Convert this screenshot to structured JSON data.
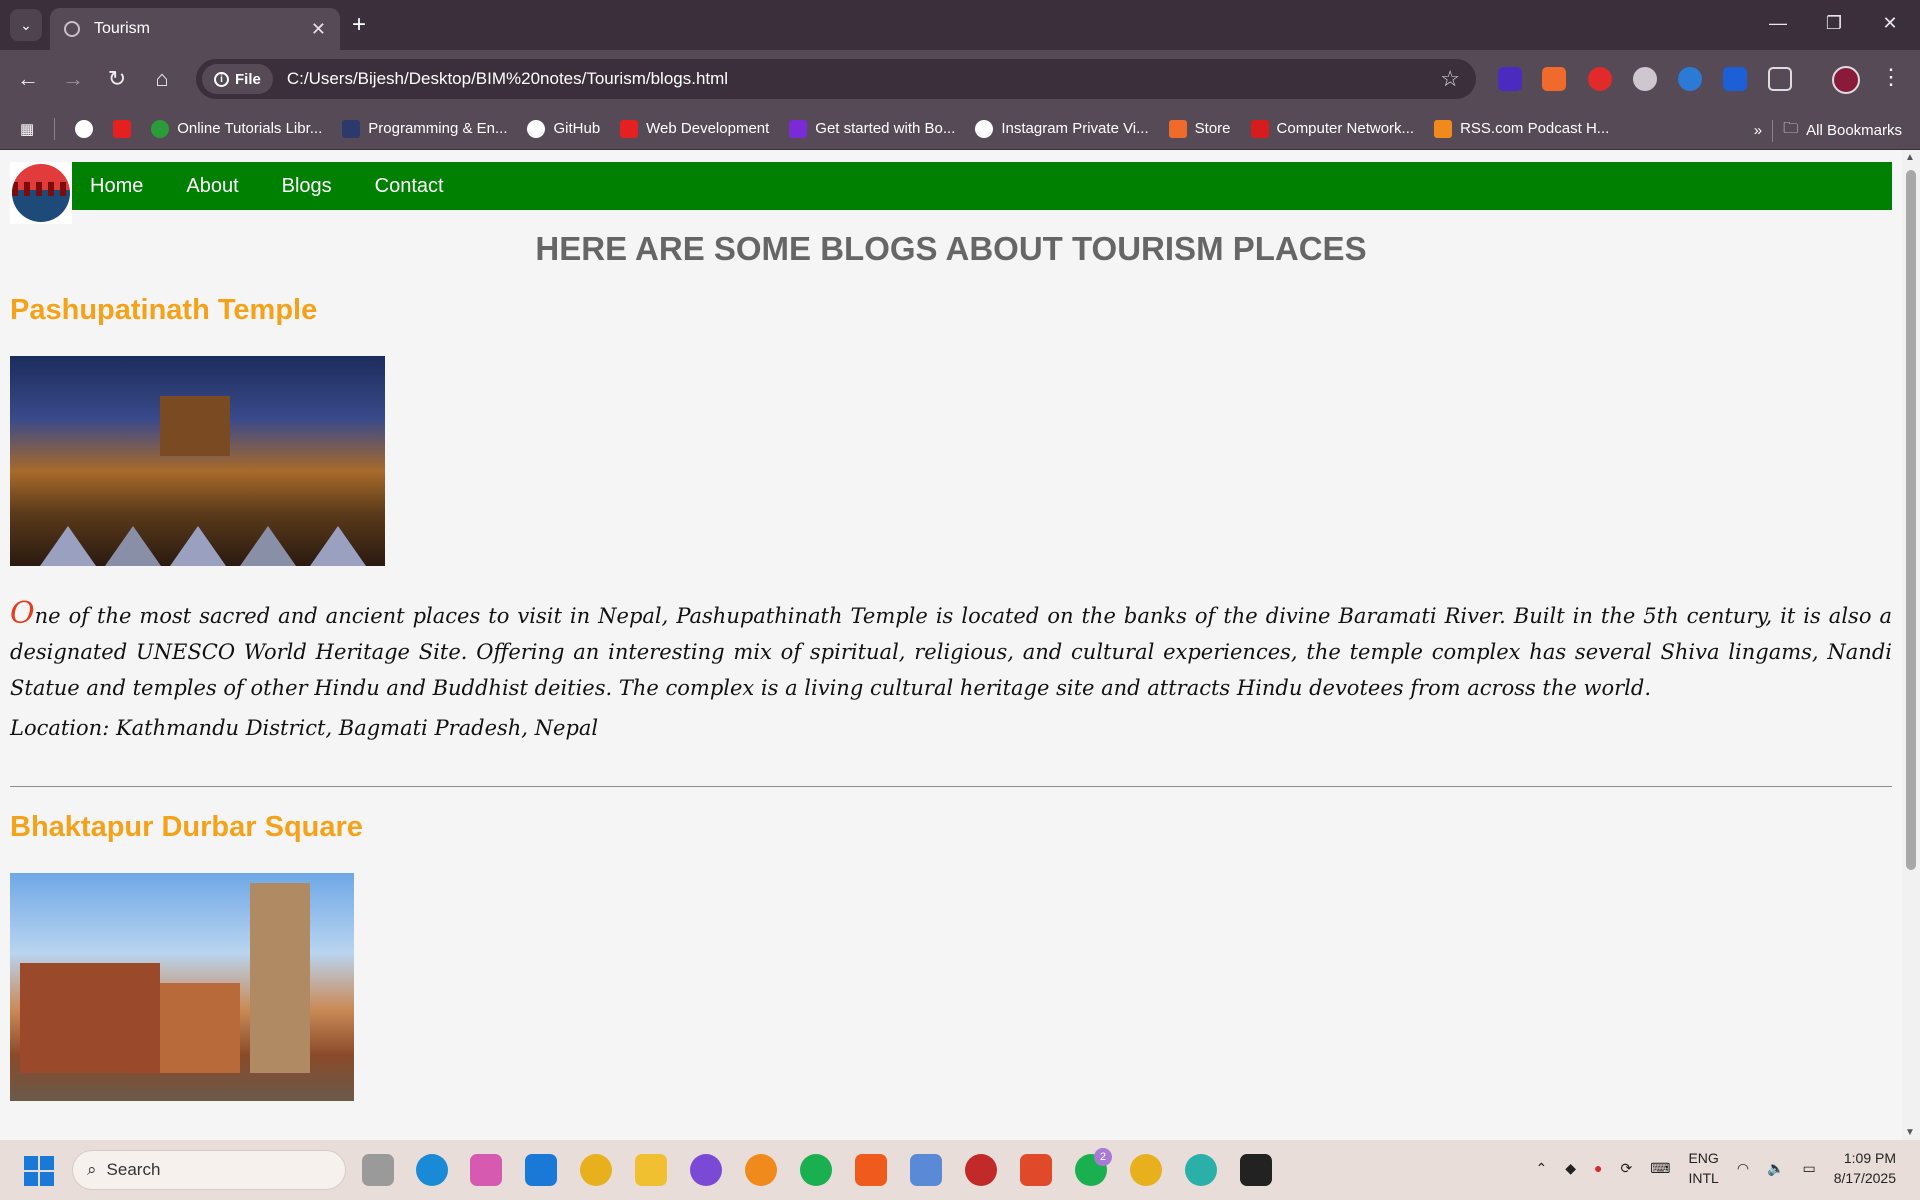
{
  "browser": {
    "tab_title": "Tourism",
    "file_chip": "File",
    "url": "C:/Users/Bijesh/Desktop/BIM%20notes/Tourism/blogs.html",
    "bookmarks": [
      "Online Tutorials Libr...",
      "Programming & En...",
      "GitHub",
      "Web Development",
      "Get started with Bo...",
      "Instagram Private Vi...",
      "Store",
      "Computer Network...",
      "RSS.com Podcast H..."
    ],
    "all_bookmarks": "All Bookmarks"
  },
  "site": {
    "nav": [
      "Home",
      "About",
      "Blogs",
      "Contact"
    ],
    "heading": "HERE ARE SOME BLOGS ABOUT TOURISM PLACES",
    "blogs": [
      {
        "title": "Pashupatinath Temple",
        "dropcap": "O",
        "body": "ne of the most sacred and ancient places to visit in Nepal, Pashupathinath Temple is located on the banks of the divine Baramati River. Built in the 5th century, it is also a designated UNESCO World Heritage Site. Offering an interesting mix of spiritual, religious, and cultural experiences, the temple complex has several Shiva lingams, Nandi Statue and temples of other Hindu and Buddhist deities. The complex is a living cultural heritage site and attracts Hindu devotees from across the world.",
        "location": "Location: Kathmandu District, Bagmati Pradesh, Nepal"
      },
      {
        "title": "Bhaktapur Durbar Square"
      }
    ]
  },
  "taskbar": {
    "search_label": "Search",
    "lang_line1": "ENG",
    "lang_line2": "INTL",
    "time": "1:09 PM",
    "date": "8/17/2025",
    "badge_whatsapp": "2"
  },
  "colors": {
    "nav_green": "#008000",
    "blog_title_orange": "#f5a21b",
    "heading_gray": "#666666",
    "dropcap_red": "#e63b1b"
  }
}
